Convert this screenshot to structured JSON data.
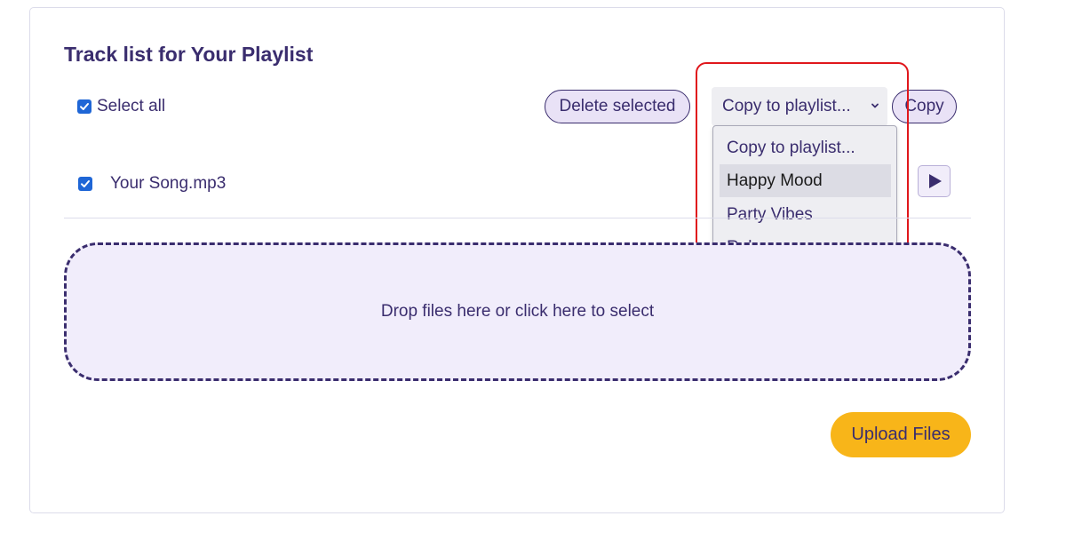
{
  "header": {
    "title": "Track list for Your Playlist"
  },
  "controls": {
    "select_all_label": "Select all",
    "select_all_checked": true,
    "delete_selected_label": "Delete selected",
    "copy_select_value": "Copy to playlist...",
    "copy_button_label": "Copy"
  },
  "dropdown": {
    "options": [
      "Copy to playlist...",
      "Happy Mood",
      "Party Vibes",
      "Relax"
    ],
    "hovered_option": "Happy Mood"
  },
  "tracks": [
    {
      "name": "Your Song.mp3",
      "checked": true
    }
  ],
  "dropzone": {
    "text": "Drop files here or click here to select"
  },
  "upload": {
    "label": "Upload Files"
  },
  "colors": {
    "primary": "#3a2d6e",
    "accent": "#f8b519",
    "checkbox": "#1f66d6",
    "highlight": "#e0171c",
    "dropzone_bg": "#f1edfb"
  },
  "icons": {
    "checkbox": "checkmark-icon",
    "select_arrow": "chevron-down-icon",
    "play": "play-icon"
  }
}
